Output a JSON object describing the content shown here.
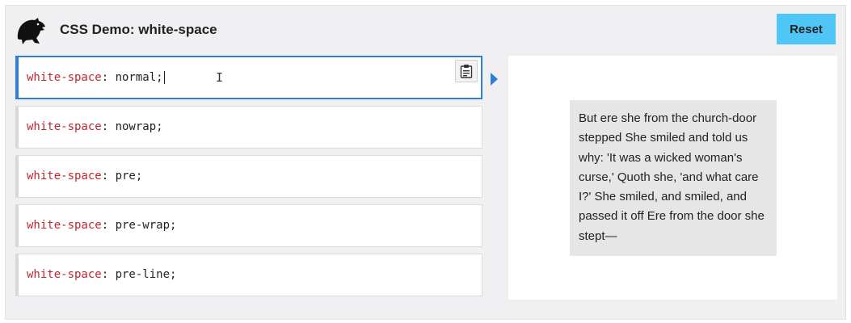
{
  "header": {
    "title": "CSS Demo: white-space",
    "reset_label": "Reset"
  },
  "choices": [
    {
      "property": "white-space",
      "value": "normal",
      "selected": true
    },
    {
      "property": "white-space",
      "value": "nowrap",
      "selected": false
    },
    {
      "property": "white-space",
      "value": "pre",
      "selected": false
    },
    {
      "property": "white-space",
      "value": "pre-wrap",
      "selected": false
    },
    {
      "property": "white-space",
      "value": "pre-line",
      "selected": false
    }
  ],
  "output": {
    "text": "But ere she from the church-door stepped She smiled and told us why: 'It was a wicked woman's curse,' Quoth she, 'and what care I?' She smiled, and smiled, and passed it off Ere from the door she stept—"
  },
  "colors": {
    "accent": "#2f7ed8",
    "reset_button": "#4fc6f5",
    "property_name": "#c0262d"
  },
  "icons": {
    "logo": "dinosaur-head-icon",
    "copy": "clipboard-icon",
    "selected_indicator": "triangle-right-icon"
  }
}
